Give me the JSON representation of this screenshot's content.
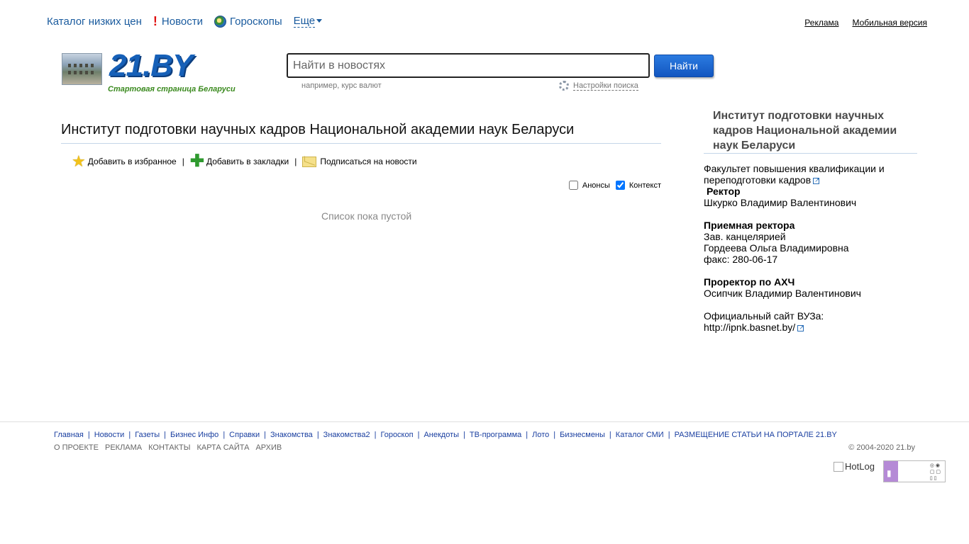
{
  "topnav": {
    "catalog": "Каталог низких цен",
    "news": "Новости",
    "horoscopes": "Гороскопы",
    "more": "Еще"
  },
  "toplinks": {
    "ads": "Реклама",
    "mobile": "Мобильная версия"
  },
  "logo": {
    "text": "21.BY",
    "subtitle": "Стартовая страница Беларуси"
  },
  "search": {
    "placeholder": "Найти в новостях",
    "button": "Найти",
    "hint": "например, курс валют",
    "settings": "Настройки поиска"
  },
  "main": {
    "title": "Институт подготовки научных кадров Национальной академии наук Беларуси",
    "actions": {
      "favorite": "Добавить в избранное",
      "bookmarks": "Добавить в закладки",
      "subscribe": "Подписаться на новости"
    },
    "filters": {
      "announcements": "Анонсы",
      "context": "Контекст"
    },
    "empty": "Список пока пустой"
  },
  "sidebar": {
    "title": "Институт подготовки научных кадров Национальной академии наук Беларуси",
    "faculty": "Факультет повышения квалификации и переподготовки кадров",
    "rector_label": "Ректор",
    "rector_name": "Шкурко Владимир Валентинович",
    "reception_label": "Приемная ректора",
    "reception_role": "Зав. канцелярией",
    "reception_name": "Гордеева Ольга Владимировна",
    "reception_fax": "факс: 280-06-17",
    "prorector_label": "Проректор по АХЧ",
    "prorector_name": "Осипчик Владимир Валентинович",
    "site_label": "Официальный сайт ВУЗа:",
    "site_url": "http://ipnk.basnet.by/"
  },
  "footer": {
    "links": [
      "Главная",
      "Новости",
      "Газеты",
      "Бизнес Инфо",
      "Справки",
      "Знакомства",
      "Знакомства2",
      "Гороскоп",
      "Анекдоты",
      "ТВ-программа",
      "Лото",
      "Бизнесмены",
      "Каталог СМИ",
      "РАЗМЕЩЕНИЕ СТАТЬИ НА ПОРТАЛЕ 21.BY"
    ],
    "links2": [
      "О ПРОЕКТЕ",
      "РЕКЛАМА",
      "КОНТАКТЫ",
      "КАРТА САЙТА",
      "АРХИВ"
    ],
    "copyright": "© 2004-2020 21.by",
    "hotlog": "HotLog"
  },
  "colors": {
    "link": "#1a5b9e",
    "button": "#1660b8",
    "logo_green": "#3b8a1f"
  }
}
